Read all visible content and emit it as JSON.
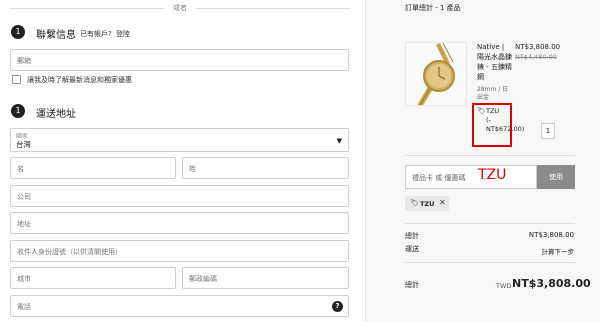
{
  "divider": {
    "or_text": "或者"
  },
  "contact": {
    "step_number": "1",
    "title": "聯繫信息",
    "have_account": "已有帳戶?",
    "login": "登陸",
    "email_placeholder": "郵箱",
    "newsletter_label": "讓我及時了解最新消息和獨家優惠"
  },
  "shipping": {
    "step_number": "1",
    "title": "運送地址",
    "country_label": "國家",
    "country_value": "台灣",
    "first_name_placeholder": "名",
    "last_name_placeholder": "姓",
    "company_placeholder": "公司",
    "address_placeholder": "地址",
    "recipient_id_placeholder": "收件人身份證號（以供清關使用）",
    "city_placeholder": "城市",
    "postal_placeholder": "郵政編碼",
    "phone_placeholder": "電話",
    "help_glyph": "?"
  },
  "summary": {
    "title": "訂單總計 - 1 產品",
    "product": {
      "name": "Native | 陽光水晶鍊錶 - 五鍊精鋼",
      "variant": "28mm / 日出金",
      "price": "NT$3,808.00",
      "old_price": "NT$4,480.00",
      "discount_code": "TZU",
      "discount_amount": "(-NT$672.00)",
      "quantity": "1"
    },
    "code_placeholder": "禮品卡 或 優惠碼",
    "code_annotation": "TZU",
    "apply_label": "使用",
    "applied_chip": "TZU",
    "chip_close": "✕",
    "subtotal_label": "總計",
    "subtotal_value": "NT$3,808.00",
    "shipping_label": "運送",
    "shipping_value": "計算下一步",
    "total_label": "總計",
    "total_currency": "TWD",
    "total_value": "NT$3,808.00"
  },
  "colors": {
    "annotation": "#dd0000",
    "button": "#8a8a8a",
    "step": "#222222"
  }
}
